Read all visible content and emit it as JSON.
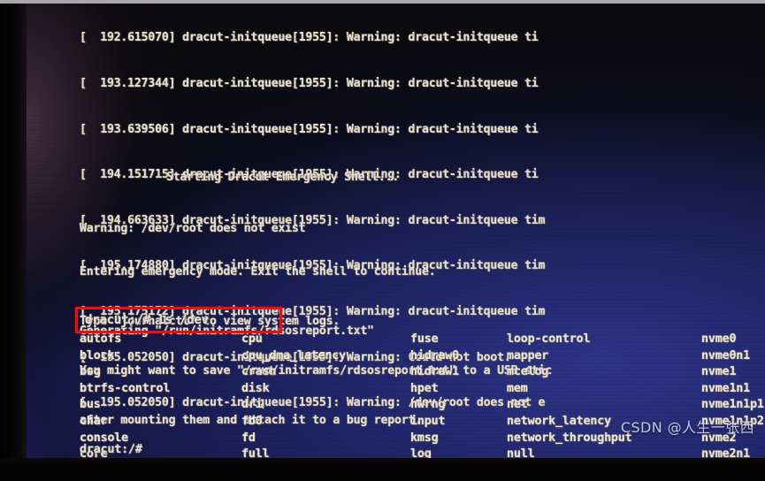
{
  "screen": {
    "kernel_log": [
      {
        "time": "192.615070",
        "unit": "dracut-initqueue[1955]",
        "level": "Warning:",
        "message": "dracut-initqueue ti"
      },
      {
        "time": "193.127344",
        "unit": "dracut-initqueue[1955]",
        "level": "Warning:",
        "message": "dracut-initqueue ti"
      },
      {
        "time": "193.639506",
        "unit": "dracut-initqueue[1955]",
        "level": "Warning:",
        "message": "dracut-initqueue ti"
      },
      {
        "time": "194.151715",
        "unit": "dracut-initqueue[1955]",
        "level": "Warning:",
        "message": "dracut-initqueue ti"
      },
      {
        "time": "194.663633",
        "unit": "dracut-initqueue[1955]",
        "level": "Warning:",
        "message": "dracut-initqueue tim"
      },
      {
        "time": "195.174880",
        "unit": "dracut-initqueue[1955]",
        "level": "Warning:",
        "message": "dracut-initqueue tim"
      },
      {
        "time": "195.175172",
        "unit": "dracut-initqueue[1955]",
        "level": "Warning:",
        "message": "dracut-initqueue tim"
      },
      {
        "time": "195.052050",
        "unit": "dracut-initqueue[1955]",
        "level": "Warning:",
        "message": "Could not boot."
      },
      {
        "time": "195.052050",
        "unit": "dracut-initqueue[1955]",
        "level": "Warning:",
        "message": "/dev/root does not e"
      }
    ],
    "log_lines": [
      "[  192.615070] dracut-initqueue[1955]: Warning: dracut-initqueue ti",
      "[  193.127344] dracut-initqueue[1955]: Warning: dracut-initqueue ti",
      "[  193.639506] dracut-initqueue[1955]: Warning: dracut-initqueue ti",
      "[  194.151715] dracut-initqueue[1955]: Warning: dracut-initqueue ti",
      "[  194.663633] dracut-initqueue[1955]: Warning: dracut-initqueue tim",
      "[  195.174880] dracut-initqueue[1955]: Warning: dracut-initqueue tim",
      "[  195.175172] dracut-initqueue[1955]: Warning: dracut-initqueue tim",
      "[  195.052050] dracut-initqueue[1955]: Warning: Could not boot.",
      "[  195.052050] dracut-initqueue[1955]: Warning: /dev/root does not e"
    ],
    "starting_shell": "Starting Dracut Emergency Shell...",
    "warning_root": "Warning: /dev/root does not exist",
    "generating": "Generating \"/run/initramfs/rdsosreport.txt\"",
    "emergency": [
      "Entering emergency mode. Exit the shell to continue.",
      "Type \"journalctl\" to view system logs.",
      "You might want to save \"/run/initramfs/rdsosreport.txt\" to a USB stic",
      "after mounting them and attach it to a bug report."
    ],
    "prompt_command": "dracut:/# ls /dev",
    "prompt_idle": "dracut:/#",
    "dev_columns": [
      [
        "autofs",
        "block",
        "bsg",
        "btrfs-control",
        "bus",
        "char",
        "console",
        "core"
      ],
      [
        "cpu",
        "cpu_dma_latency",
        "crash",
        "disk",
        "dri",
        "fb0",
        "fd",
        "full"
      ],
      [
        "fuse",
        "hidraw0",
        "hidraw1",
        "hpet",
        "hwrng",
        "input",
        "kmsg",
        "log"
      ],
      [
        "loop-control",
        "mapper",
        "mcelog",
        "mem",
        "net",
        "network_latency",
        "network_throughput",
        "null"
      ],
      [
        "nvme0",
        "nvme0n1",
        "nvme1",
        "nvme1n1",
        "nvme1n1p1",
        "nvme1n1p2",
        "nvme2",
        "nvme2n1"
      ]
    ],
    "watermark": "CSDN @人生一张西",
    "highlight_color": "#ee1111",
    "text_color": "#e7e2d4",
    "screen_bg_color": "#23276f"
  }
}
